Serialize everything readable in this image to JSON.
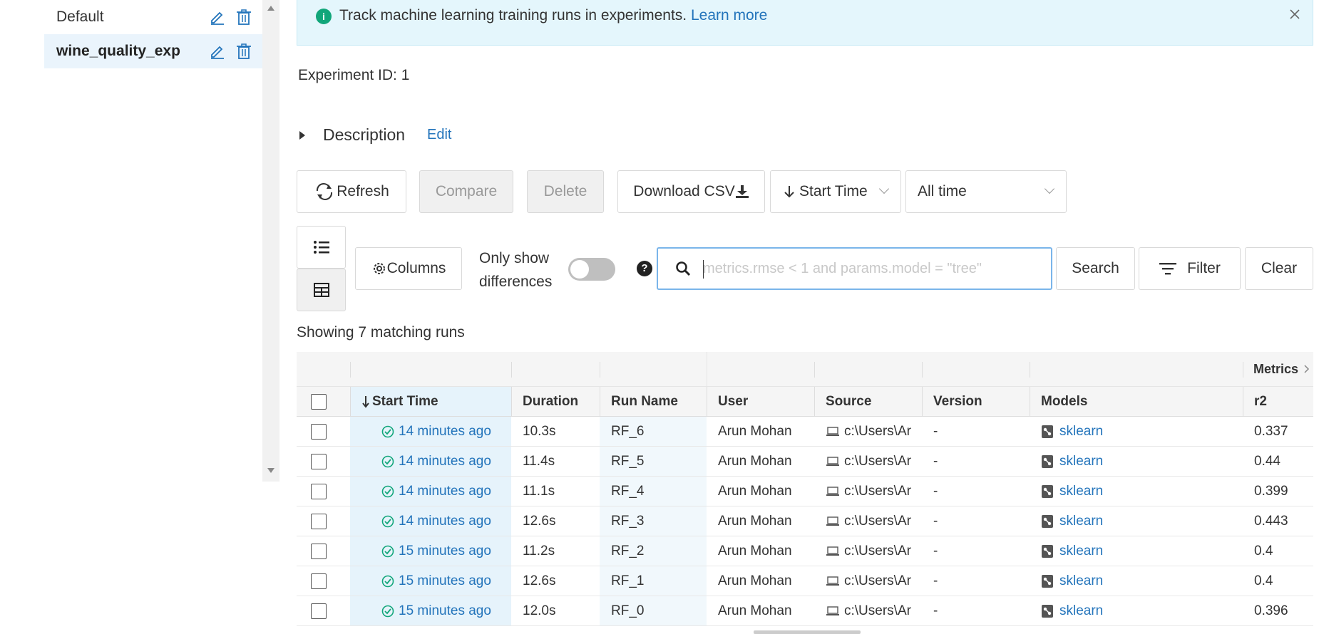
{
  "sidebar": {
    "experiments": [
      {
        "name": "Default",
        "active": false
      },
      {
        "name": "wine_quality_exp",
        "active": true
      }
    ]
  },
  "banner": {
    "message": "Track machine learning training runs in experiments.",
    "link": "Learn more"
  },
  "experiment": {
    "id_label": "Experiment ID:",
    "id_value": "1"
  },
  "description": {
    "label": "Description",
    "edit": "Edit"
  },
  "toolbar": {
    "refresh": "Refresh",
    "compare": "Compare",
    "delete": "Delete",
    "download_csv": "Download CSV",
    "sort_by": "Start Time",
    "time_range": "All time",
    "columns": "Columns",
    "only_show_line1": "Only show",
    "only_show_line2": "differences",
    "search_placeholder": "metrics.rmse < 1 and params.model = \"tree\"",
    "search": "Search",
    "filter": "Filter",
    "clear": "Clear"
  },
  "results": {
    "showing": "Showing 7 matching runs"
  },
  "table": {
    "group_metrics": "Metrics",
    "headers": {
      "start_time": "Start Time",
      "duration": "Duration",
      "run_name": "Run Name",
      "user": "User",
      "source": "Source",
      "version": "Version",
      "models": "Models",
      "r2": "r2"
    },
    "rows": [
      {
        "start_time": "14 minutes ago",
        "duration": "10.3s",
        "run_name": "RF_6",
        "user": "Arun Mohan",
        "source": "c:\\Users\\Ar",
        "version": "-",
        "model": "sklearn",
        "r2": "0.337"
      },
      {
        "start_time": "14 minutes ago",
        "duration": "11.4s",
        "run_name": "RF_5",
        "user": "Arun Mohan",
        "source": "c:\\Users\\Ar",
        "version": "-",
        "model": "sklearn",
        "r2": "0.44"
      },
      {
        "start_time": "14 minutes ago",
        "duration": "11.1s",
        "run_name": "RF_4",
        "user": "Arun Mohan",
        "source": "c:\\Users\\Ar",
        "version": "-",
        "model": "sklearn",
        "r2": "0.399"
      },
      {
        "start_time": "14 minutes ago",
        "duration": "12.6s",
        "run_name": "RF_3",
        "user": "Arun Mohan",
        "source": "c:\\Users\\Ar",
        "version": "-",
        "model": "sklearn",
        "r2": "0.443"
      },
      {
        "start_time": "15 minutes ago",
        "duration": "11.2s",
        "run_name": "RF_2",
        "user": "Arun Mohan",
        "source": "c:\\Users\\Ar",
        "version": "-",
        "model": "sklearn",
        "r2": "0.4"
      },
      {
        "start_time": "15 minutes ago",
        "duration": "12.6s",
        "run_name": "RF_1",
        "user": "Arun Mohan",
        "source": "c:\\Users\\Ar",
        "version": "-",
        "model": "sklearn",
        "r2": "0.4"
      },
      {
        "start_time": "15 minutes ago",
        "duration": "12.0s",
        "run_name": "RF_0",
        "user": "Arun Mohan",
        "source": "c:\\Users\\Ar",
        "version": "-",
        "model": "sklearn",
        "r2": "0.396"
      }
    ]
  },
  "colors": {
    "accent": "#2374bb",
    "success": "#11a67a",
    "selected_bg": "#eaf4fc",
    "banner_bg": "#e4f6fc"
  }
}
